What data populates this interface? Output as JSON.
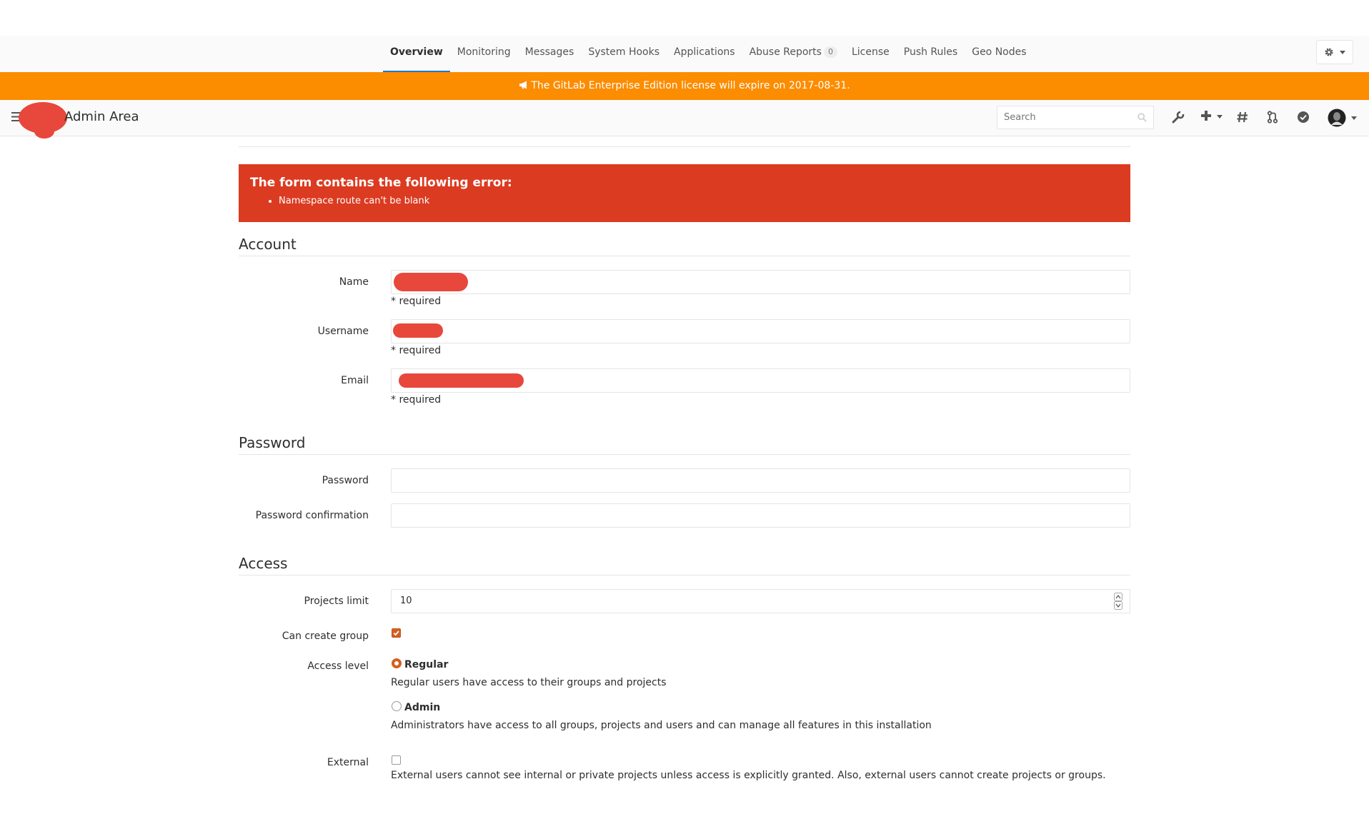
{
  "admin_tabs": {
    "items": [
      {
        "label": "Overview",
        "active": true
      },
      {
        "label": "Monitoring"
      },
      {
        "label": "Messages"
      },
      {
        "label": "System Hooks"
      },
      {
        "label": "Applications"
      },
      {
        "label": "Abuse Reports",
        "badge": "0"
      },
      {
        "label": "License"
      },
      {
        "label": "Push Rules"
      },
      {
        "label": "Geo Nodes"
      }
    ]
  },
  "license_banner": {
    "text": "The GitLab Enterprise Edition license will expire on 2017-08-31."
  },
  "navbar": {
    "title": "Admin Area",
    "search_placeholder": "Search"
  },
  "error": {
    "heading": "The form contains the following error:",
    "items": [
      "Namespace route can't be blank"
    ]
  },
  "account": {
    "title": "Account",
    "name_label": "Name",
    "username_label": "Username",
    "email_label": "Email",
    "required_text": "* required"
  },
  "password": {
    "title": "Password",
    "password_label": "Password",
    "confirmation_label": "Password confirmation"
  },
  "access": {
    "title": "Access",
    "projects_limit_label": "Projects limit",
    "projects_limit_value": "10",
    "can_create_group_label": "Can create group",
    "can_create_group_checked": true,
    "access_level_label": "Access level",
    "regular_label": "Regular",
    "regular_help": "Regular users have access to their groups and projects",
    "admin_label": "Admin",
    "admin_help": "Administrators have access to all groups, projects and users and can manage all features in this installation",
    "selected_level": "Regular",
    "external_label": "External",
    "external_help": "External users cannot see internal or private projects unless access is explicitly granted. Also, external users cannot create projects or groups.",
    "external_checked": false
  },
  "colors": {
    "accent": "#fc8c00",
    "error": "#db3b21",
    "check": "#d2611f",
    "redaction": "#e8473c"
  }
}
